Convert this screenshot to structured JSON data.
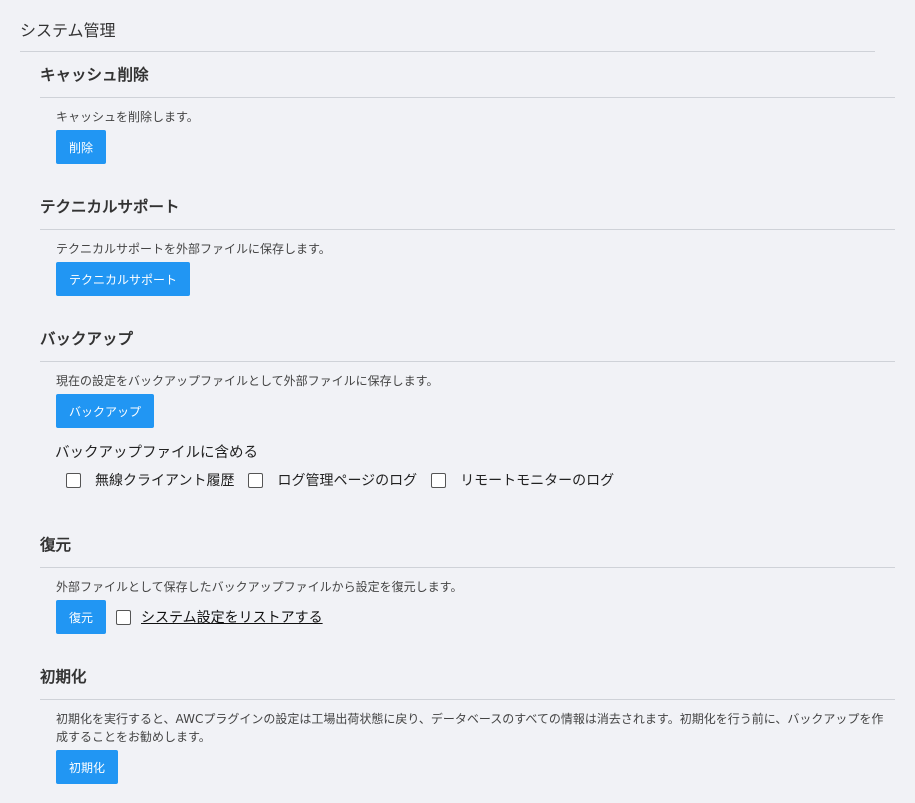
{
  "page": {
    "title": "システム管理"
  },
  "cache": {
    "heading": "キャッシュ削除",
    "description": "キャッシュを削除します。",
    "button": "削除"
  },
  "support": {
    "heading": "テクニカルサポート",
    "description": "テクニカルサポートを外部ファイルに保存します。",
    "button": "テクニカルサポート"
  },
  "backup": {
    "heading": "バックアップ",
    "description": "現在の設定をバックアップファイルとして外部ファイルに保存します。",
    "button": "バックアップ",
    "include_label": "バックアップファイルに含める",
    "options": [
      {
        "label": "無線クライアント履歴",
        "checked": false
      },
      {
        "label": "ログ管理ページのログ",
        "checked": false
      },
      {
        "label": "リモートモニターのログ",
        "checked": false
      }
    ]
  },
  "restore": {
    "heading": "復元",
    "description": "外部ファイルとして保存したバックアップファイルから設定を復元します。",
    "button": "復元",
    "option_label": "システム設定をリストアする",
    "option_checked": false
  },
  "init": {
    "heading": "初期化",
    "description": "初期化を実行すると、AWCプラグインの設定は工場出荷状態に戻り、データベースのすべての情報は消去されます。初期化を行う前に、バックアップを作成することをお勧めします。",
    "button": "初期化"
  },
  "colors": {
    "accent": "#2196f3",
    "background": "#f1f2f6",
    "rule": "#cfd2d8"
  }
}
